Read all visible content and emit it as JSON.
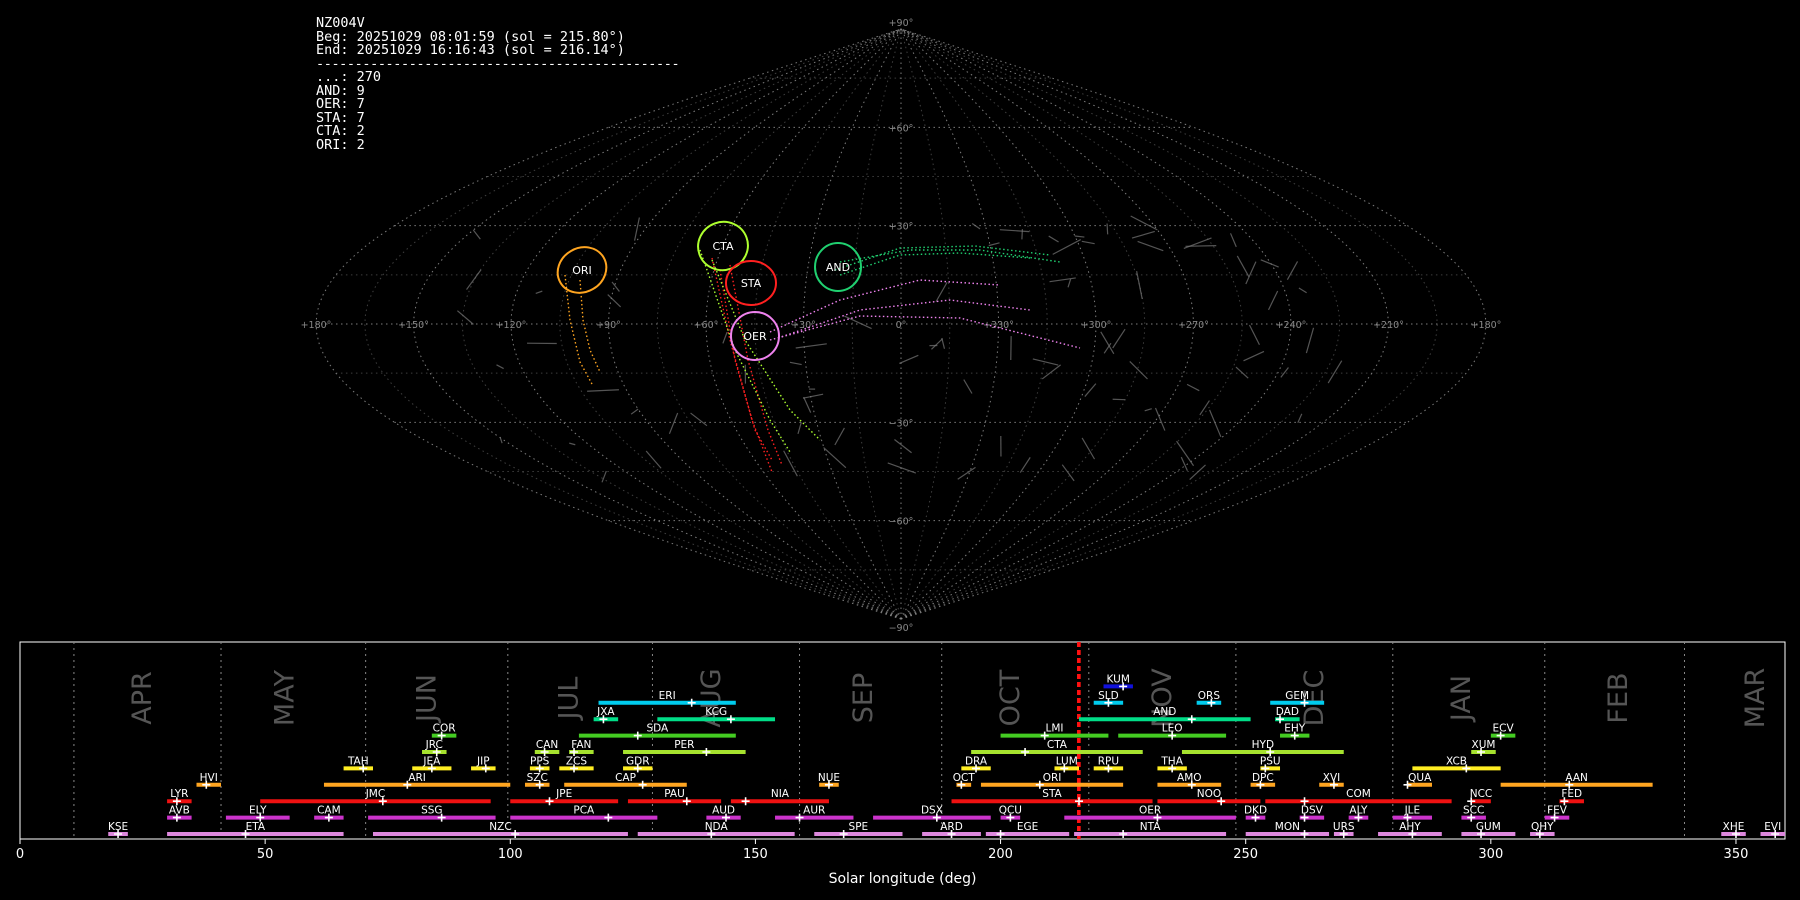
{
  "info": {
    "station": "NZ004V",
    "begin": "Beg: 20251029 08:01:59 (sol = 215.80°)",
    "end": "End: 20251029 16:16:43 (sol = 216.14°)",
    "separator": "-----------------------------------------------",
    "counts": [
      {
        "label": "...",
        "value": 270
      },
      {
        "label": "AND",
        "value": 9
      },
      {
        "label": "OER",
        "value": 7
      },
      {
        "label": "STA",
        "value": 7
      },
      {
        "label": "CTA",
        "value": 2
      },
      {
        "label": "ORI",
        "value": 2
      }
    ]
  },
  "sky_map": {
    "projection": "sinusoidal",
    "lon_labels": [
      "+180°",
      "+150°",
      "+120°",
      "+90°",
      "+60°",
      "+30°",
      "0°",
      "+330°",
      "+300°",
      "+270°",
      "+240°",
      "+210°",
      "+180°"
    ],
    "lat_labels": [
      "+90°",
      "+60°",
      "+30°",
      "0°",
      "−30°",
      "−60°",
      "−90°"
    ],
    "radiants": [
      {
        "code": "ORI",
        "lon": 97,
        "lat": 0,
        "color": "#ffa520"
      },
      {
        "code": "CTA",
        "lon": 57,
        "lat": 8,
        "color": "#adff2f"
      },
      {
        "code": "STA",
        "lon": 45,
        "lat": -4,
        "color": "#ff2020"
      },
      {
        "code": "AND",
        "lon": 18,
        "lat": 1,
        "color": "#20d070"
      },
      {
        "code": "OER",
        "lon": 43,
        "lat": -19,
        "color": "#ee82ee"
      }
    ]
  },
  "chart_data": {
    "type": "timeline",
    "xlabel": "Solar longitude (deg)",
    "xlim": [
      0,
      360
    ],
    "xticks": [
      0,
      50,
      100,
      150,
      200,
      250,
      300,
      350
    ],
    "current_sol": [
      215.8,
      216.14
    ],
    "months": [
      {
        "label": "APR",
        "pos": 25,
        "boundary": 11
      },
      {
        "label": "MAY",
        "pos": 54,
        "boundary": 41
      },
      {
        "label": "JUN",
        "pos": 83,
        "boundary": 70.5
      },
      {
        "label": "JUL",
        "pos": 112,
        "boundary": 99.5
      },
      {
        "label": "AUG",
        "pos": 141,
        "boundary": 129
      },
      {
        "label": "SEP",
        "pos": 172,
        "boundary": 159
      },
      {
        "label": "OCT",
        "pos": 202,
        "boundary": 188
      },
      {
        "label": "NOV",
        "pos": 233,
        "boundary": 218
      },
      {
        "label": "DEC",
        "pos": 264,
        "boundary": 248
      },
      {
        "label": "JAN",
        "pos": 294,
        "boundary": 280
      },
      {
        "label": "FEB",
        "pos": 326,
        "boundary": 311
      },
      {
        "label": "MAR",
        "pos": 354,
        "boundary": 339.5
      }
    ],
    "showers": [
      {
        "code": "KUM",
        "start": 221,
        "end": 227,
        "peak": 225,
        "row": 9,
        "color": "#1111dd"
      },
      {
        "code": "ERI",
        "start": 118,
        "end": 146,
        "peak": 137,
        "row": 8,
        "color": "#00ccee"
      },
      {
        "code": "SLD",
        "start": 219,
        "end": 225,
        "peak": 222,
        "row": 8,
        "color": "#00ccee"
      },
      {
        "code": "ORS",
        "start": 240,
        "end": 245,
        "peak": 243,
        "row": 8,
        "color": "#00ccee"
      },
      {
        "code": "GEM",
        "start": 255,
        "end": 266,
        "peak": 262,
        "row": 8,
        "color": "#00ccee"
      },
      {
        "code": "JXA",
        "start": 117,
        "end": 122,
        "peak": 119,
        "row": 7,
        "color": "#00dd88"
      },
      {
        "code": "KCG",
        "start": 130,
        "end": 154,
        "peak": 145,
        "row": 7,
        "color": "#00dd88"
      },
      {
        "code": "AND",
        "start": 216,
        "end": 251,
        "peak": 239,
        "row": 7,
        "color": "#00dd88"
      },
      {
        "code": "DAD",
        "start": 256,
        "end": 261,
        "peak": 257,
        "row": 7,
        "color": "#00dd88"
      },
      {
        "code": "COR",
        "start": 84,
        "end": 89,
        "peak": 86,
        "row": 6,
        "color": "#44cc22"
      },
      {
        "code": "SDA",
        "start": 114,
        "end": 146,
        "peak": 126,
        "row": 6,
        "color": "#44cc22"
      },
      {
        "code": "LMI",
        "start": 200,
        "end": 222,
        "peak": 209,
        "row": 6,
        "color": "#44cc22"
      },
      {
        "code": "LEO",
        "start": 224,
        "end": 246,
        "peak": 235,
        "row": 6,
        "color": "#44cc22"
      },
      {
        "code": "EHY",
        "start": 257,
        "end": 263,
        "peak": 260,
        "row": 6,
        "color": "#44cc22"
      },
      {
        "code": "ECV",
        "start": 300,
        "end": 305,
        "peak": 302,
        "row": 6,
        "color": "#44cc22"
      },
      {
        "code": "JRC",
        "start": 82,
        "end": 87,
        "peak": 85,
        "row": 5,
        "color": "#a6e22e"
      },
      {
        "code": "CAN",
        "start": 105,
        "end": 110,
        "peak": 107,
        "row": 5,
        "color": "#a6e22e"
      },
      {
        "code": "FAN",
        "start": 112,
        "end": 117,
        "peak": 113,
        "row": 5,
        "color": "#a6e22e"
      },
      {
        "code": "PER",
        "start": 123,
        "end": 148,
        "peak": 140,
        "row": 5,
        "color": "#a6e22e"
      },
      {
        "code": "CTA",
        "start": 194,
        "end": 229,
        "peak": 205,
        "row": 5,
        "color": "#a6e22e"
      },
      {
        "code": "HYD",
        "start": 237,
        "end": 270,
        "peak": 255,
        "row": 5,
        "color": "#a6e22e"
      },
      {
        "code": "XUM",
        "start": 296,
        "end": 301,
        "peak": 298,
        "row": 5,
        "color": "#a6e22e"
      },
      {
        "code": "TAH",
        "start": 66,
        "end": 72,
        "peak": 70,
        "row": 4,
        "color": "#ffee22"
      },
      {
        "code": "JEA",
        "start": 80,
        "end": 88,
        "peak": 84,
        "row": 4,
        "color": "#ffee22"
      },
      {
        "code": "JIP",
        "start": 92,
        "end": 97,
        "peak": 95,
        "row": 4,
        "color": "#ffee22"
      },
      {
        "code": "PPS",
        "start": 104,
        "end": 108,
        "peak": 106,
        "row": 4,
        "color": "#ffee22"
      },
      {
        "code": "ZCS",
        "start": 110,
        "end": 117,
        "peak": 113,
        "row": 4,
        "color": "#ffee22"
      },
      {
        "code": "GDR",
        "start": 123,
        "end": 129,
        "peak": 126,
        "row": 4,
        "color": "#ffee22"
      },
      {
        "code": "DRA",
        "start": 192,
        "end": 198,
        "peak": 195,
        "row": 4,
        "color": "#ffee22"
      },
      {
        "code": "LUM",
        "start": 211,
        "end": 216,
        "peak": 213,
        "row": 4,
        "color": "#ffee22"
      },
      {
        "code": "RPU",
        "start": 219,
        "end": 225,
        "peak": 222,
        "row": 4,
        "color": "#ffee22"
      },
      {
        "code": "THA",
        "start": 232,
        "end": 238,
        "peak": 235,
        "row": 4,
        "color": "#ffee22"
      },
      {
        "code": "PSU",
        "start": 253,
        "end": 257,
        "peak": 254,
        "row": 4,
        "color": "#ffee22"
      },
      {
        "code": "XCB",
        "start": 284,
        "end": 302,
        "peak": 295,
        "row": 4,
        "color": "#ffee22"
      },
      {
        "code": "HVI",
        "start": 36,
        "end": 41,
        "peak": 38,
        "row": 3,
        "color": "#ffa520"
      },
      {
        "code": "ARI",
        "start": 62,
        "end": 100,
        "peak": 79,
        "row": 3,
        "color": "#ffa520"
      },
      {
        "code": "SZC",
        "start": 103,
        "end": 108,
        "peak": 106,
        "row": 3,
        "color": "#ffa520"
      },
      {
        "code": "CAP",
        "start": 111,
        "end": 136,
        "peak": 127,
        "row": 3,
        "color": "#ffa520"
      },
      {
        "code": "NUE",
        "start": 163,
        "end": 167,
        "peak": 165,
        "row": 3,
        "color": "#ffa520"
      },
      {
        "code": "OCT",
        "start": 191,
        "end": 194,
        "peak": 192,
        "row": 3,
        "color": "#ffa520"
      },
      {
        "code": "ORI",
        "start": 196,
        "end": 225,
        "peak": 208,
        "row": 3,
        "color": "#ffa520"
      },
      {
        "code": "AMO",
        "start": 232,
        "end": 245,
        "peak": 239,
        "row": 3,
        "color": "#ffa520"
      },
      {
        "code": "DPC",
        "start": 251,
        "end": 256,
        "peak": 253,
        "row": 3,
        "color": "#ffa520"
      },
      {
        "code": "XVI",
        "start": 265,
        "end": 270,
        "peak": 268,
        "row": 3,
        "color": "#ffa520"
      },
      {
        "code": "QUA",
        "start": 283,
        "end": 288,
        "peak": 283,
        "row": 3,
        "color": "#ffa520"
      },
      {
        "code": "AAN",
        "start": 302,
        "end": 333,
        "peak": 316,
        "row": 3,
        "color": "#ffa520"
      },
      {
        "code": "LYR",
        "start": 30,
        "end": 35,
        "peak": 32,
        "row": 2,
        "color": "#ee1111"
      },
      {
        "code": "JMC",
        "start": 49,
        "end": 96,
        "peak": 74,
        "row": 2,
        "color": "#ee1111"
      },
      {
        "code": "JPE",
        "start": 100,
        "end": 122,
        "peak": 108,
        "row": 2,
        "color": "#ee1111"
      },
      {
        "code": "PAU",
        "start": 124,
        "end": 143,
        "peak": 136,
        "row": 2,
        "color": "#ee1111"
      },
      {
        "code": "NIA",
        "start": 145,
        "end": 165,
        "peak": 148,
        "row": 2,
        "color": "#ee1111"
      },
      {
        "code": "STA",
        "start": 190,
        "end": 231,
        "peak": 216,
        "row": 2,
        "color": "#ee1111"
      },
      {
        "code": "NOO",
        "start": 232,
        "end": 253,
        "peak": 245,
        "row": 2,
        "color": "#ee1111"
      },
      {
        "code": "COM",
        "start": 254,
        "end": 292,
        "peak": 262,
        "row": 2,
        "color": "#ee1111"
      },
      {
        "code": "NCC",
        "start": 296,
        "end": 300,
        "peak": 296,
        "row": 2,
        "color": "#ee1111"
      },
      {
        "code": "FED",
        "start": 314,
        "end": 319,
        "peak": 315,
        "row": 2,
        "color": "#ee1111"
      },
      {
        "code": "AVB",
        "start": 30,
        "end": 35,
        "peak": 32,
        "row": 1,
        "color": "#cc33cc"
      },
      {
        "code": "ELY",
        "start": 42,
        "end": 55,
        "peak": 49,
        "row": 1,
        "color": "#cc33cc"
      },
      {
        "code": "CAM",
        "start": 60,
        "end": 66,
        "peak": 63,
        "row": 1,
        "color": "#cc33cc"
      },
      {
        "code": "SSG",
        "start": 71,
        "end": 97,
        "peak": 86,
        "row": 1,
        "color": "#cc33cc"
      },
      {
        "code": "PCA",
        "start": 100,
        "end": 130,
        "peak": 120,
        "row": 1,
        "color": "#cc33cc"
      },
      {
        "code": "AUD",
        "start": 140,
        "end": 147,
        "peak": 144,
        "row": 1,
        "color": "#cc33cc"
      },
      {
        "code": "AUR",
        "start": 154,
        "end": 170,
        "peak": 159,
        "row": 1,
        "color": "#cc33cc"
      },
      {
        "code": "DSX",
        "start": 174,
        "end": 198,
        "peak": 187,
        "row": 1,
        "color": "#cc33cc"
      },
      {
        "code": "QCU",
        "start": 200,
        "end": 204,
        "peak": 202,
        "row": 1,
        "color": "#cc33cc"
      },
      {
        "code": "OER",
        "start": 213,
        "end": 248,
        "peak": 232,
        "row": 1,
        "color": "#cc33cc"
      },
      {
        "code": "DKD",
        "start": 250,
        "end": 254,
        "peak": 252,
        "row": 1,
        "color": "#cc33cc"
      },
      {
        "code": "DSV",
        "start": 261,
        "end": 266,
        "peak": 262,
        "row": 1,
        "color": "#cc33cc"
      },
      {
        "code": "ALY",
        "start": 271,
        "end": 275,
        "peak": 273,
        "row": 1,
        "color": "#cc33cc"
      },
      {
        "code": "JLE",
        "start": 280,
        "end": 288,
        "peak": 283,
        "row": 1,
        "color": "#cc33cc"
      },
      {
        "code": "SCC",
        "start": 294,
        "end": 299,
        "peak": 296,
        "row": 1,
        "color": "#cc33cc"
      },
      {
        "code": "FEV",
        "start": 311,
        "end": 316,
        "peak": 313,
        "row": 1,
        "color": "#cc33cc"
      },
      {
        "code": "KSE",
        "start": 18,
        "end": 22,
        "peak": 20,
        "row": 0,
        "color": "#dd88dd"
      },
      {
        "code": "ETA",
        "start": 30,
        "end": 66,
        "peak": 46,
        "row": 0,
        "color": "#dd88dd"
      },
      {
        "code": "NZC",
        "start": 72,
        "end": 124,
        "peak": 101,
        "row": 0,
        "color": "#dd88dd"
      },
      {
        "code": "NDA",
        "start": 126,
        "end": 158,
        "peak": 141,
        "row": 0,
        "color": "#dd88dd"
      },
      {
        "code": "SPE",
        "start": 162,
        "end": 180,
        "peak": 168,
        "row": 0,
        "color": "#dd88dd"
      },
      {
        "code": "ARD",
        "start": 184,
        "end": 196,
        "peak": 190,
        "row": 0,
        "color": "#dd88dd"
      },
      {
        "code": "EGE",
        "start": 197,
        "end": 214,
        "peak": 200,
        "row": 0,
        "color": "#dd88dd"
      },
      {
        "code": "NTA",
        "start": 215,
        "end": 246,
        "peak": 225,
        "row": 0,
        "color": "#dd88dd"
      },
      {
        "code": "MON",
        "start": 250,
        "end": 267,
        "peak": 262,
        "row": 0,
        "color": "#dd88dd"
      },
      {
        "code": "URS",
        "start": 268,
        "end": 272,
        "peak": 270,
        "row": 0,
        "color": "#dd88dd"
      },
      {
        "code": "AHY",
        "start": 277,
        "end": 290,
        "peak": 284,
        "row": 0,
        "color": "#dd88dd"
      },
      {
        "code": "GUM",
        "start": 294,
        "end": 305,
        "peak": 298,
        "row": 0,
        "color": "#dd88dd"
      },
      {
        "code": "QHY",
        "start": 308,
        "end": 313,
        "peak": 310,
        "row": 0,
        "color": "#dd88dd"
      },
      {
        "code": "XHE",
        "start": 347,
        "end": 352,
        "peak": 350,
        "row": 0,
        "color": "#dd88dd"
      },
      {
        "code": "EVI",
        "start": 355,
        "end": 360,
        "peak": 358,
        "row": 0,
        "color": "#dd88dd"
      }
    ]
  }
}
